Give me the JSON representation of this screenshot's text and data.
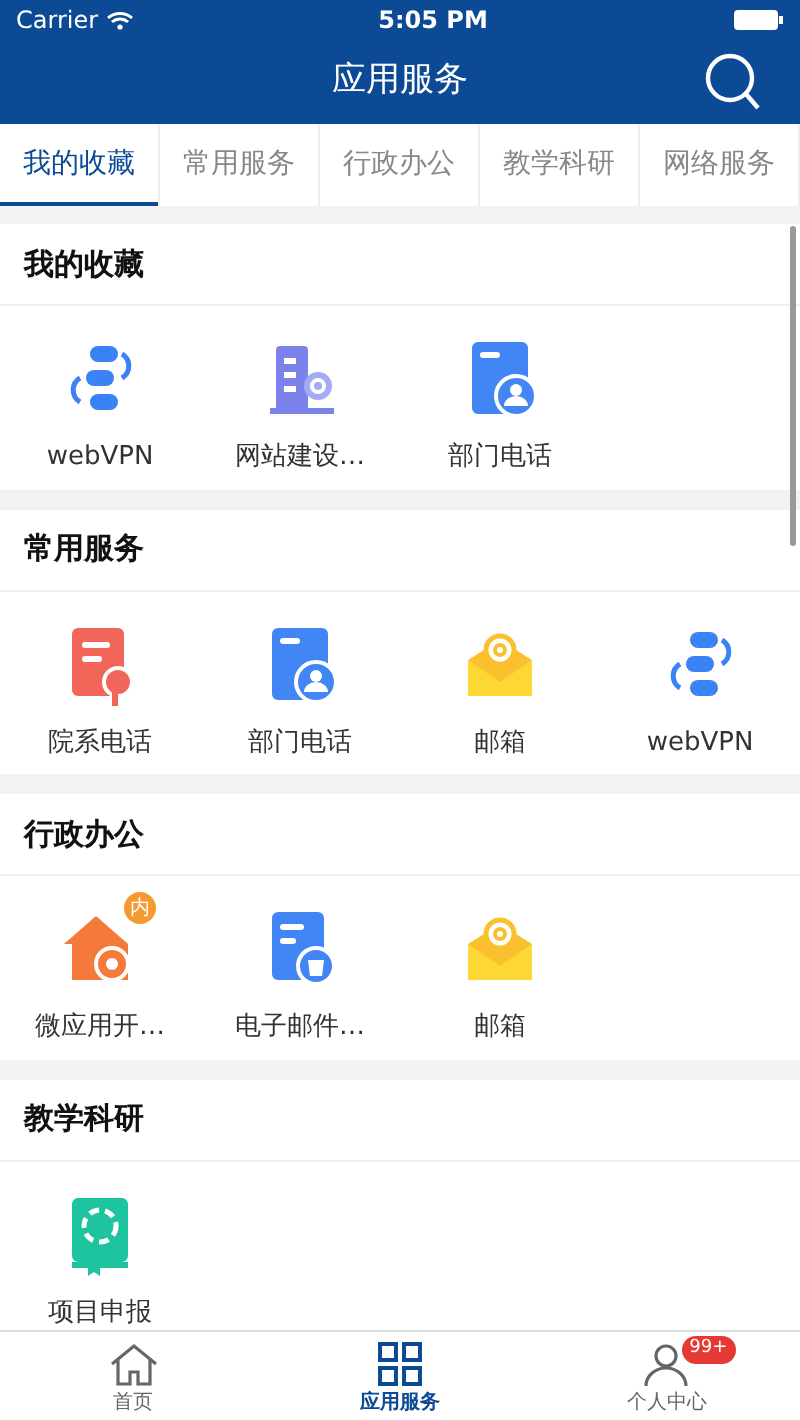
{
  "status_bar": {
    "carrier": "Carrier",
    "time": "5:05 PM"
  },
  "header": {
    "title": "应用服务"
  },
  "tabs": [
    {
      "label": "我的收藏",
      "selected": true
    },
    {
      "label": "常用服务",
      "selected": false
    },
    {
      "label": "行政办公",
      "selected": false
    },
    {
      "label": "教学科研",
      "selected": false
    },
    {
      "label": "网络服务",
      "selected": false
    }
  ],
  "sections": [
    {
      "title": "我的收藏",
      "items": [
        {
          "label": "webVPN",
          "kind": "vpn"
        },
        {
          "label": "网站建设…",
          "kind": "building"
        },
        {
          "label": "部门电话",
          "kind": "contact"
        }
      ]
    },
    {
      "title": "常用服务",
      "items": [
        {
          "label": "院系电话",
          "kind": "clipboard"
        },
        {
          "label": "部门电话",
          "kind": "contact"
        },
        {
          "label": "邮箱",
          "kind": "mail"
        },
        {
          "label": "webVPN",
          "kind": "vpn"
        }
      ]
    },
    {
      "title": "行政办公",
      "items": [
        {
          "label": "微应用开…",
          "kind": "house",
          "badge": "内"
        },
        {
          "label": "电子邮件…",
          "kind": "trash"
        },
        {
          "label": "邮箱",
          "kind": "mail"
        }
      ]
    },
    {
      "title": "教学科研",
      "items": [
        {
          "label": "项目申报",
          "kind": "book"
        }
      ]
    }
  ],
  "tab_bar": [
    {
      "label": "首页",
      "kind": "home",
      "selected": false
    },
    {
      "label": "应用服务",
      "kind": "apps",
      "selected": true
    },
    {
      "label": "个人中心",
      "kind": "person",
      "selected": false,
      "badge": "99+"
    }
  ]
}
